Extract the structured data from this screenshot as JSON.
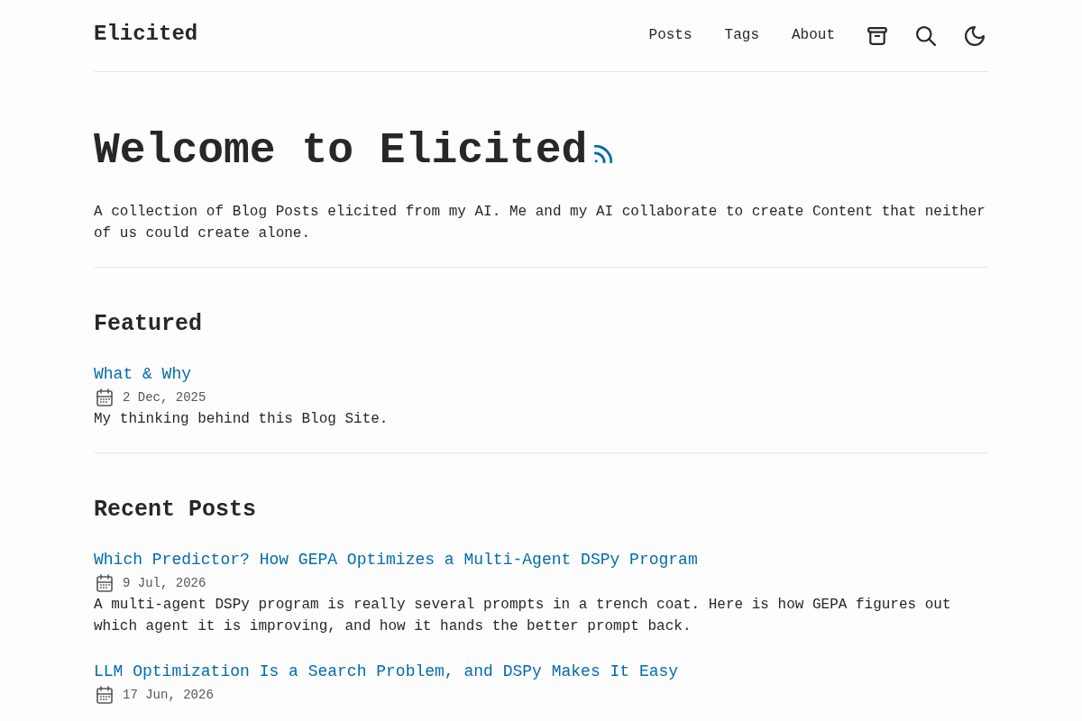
{
  "header": {
    "logo": "Elicited",
    "nav": [
      {
        "label": "Posts"
      },
      {
        "label": "Tags"
      },
      {
        "label": "About"
      }
    ]
  },
  "hero": {
    "title": "Welcome to Elicited",
    "description": "A collection of Blog Posts elicited from my AI. Me and my AI collaborate to create Content that neither of us could create alone."
  },
  "featured": {
    "heading": "Featured",
    "posts": [
      {
        "title": "What & Why",
        "date": "2 Dec, 2025",
        "summary": "My thinking behind this Blog Site."
      }
    ]
  },
  "recent": {
    "heading": "Recent Posts",
    "posts": [
      {
        "title": "Which Predictor? How GEPA Optimizes a Multi-Agent DSPy Program",
        "date": "9 Jul, 2026",
        "summary": "A multi-agent DSPy program is really several prompts in a trench coat. Here is how GEPA figures out which agent it is improving, and how it hands the better prompt back."
      },
      {
        "title": "LLM Optimization Is a Search Problem, and DSPy Makes It Easy",
        "date": "17 Jun, 2026"
      }
    ]
  }
}
